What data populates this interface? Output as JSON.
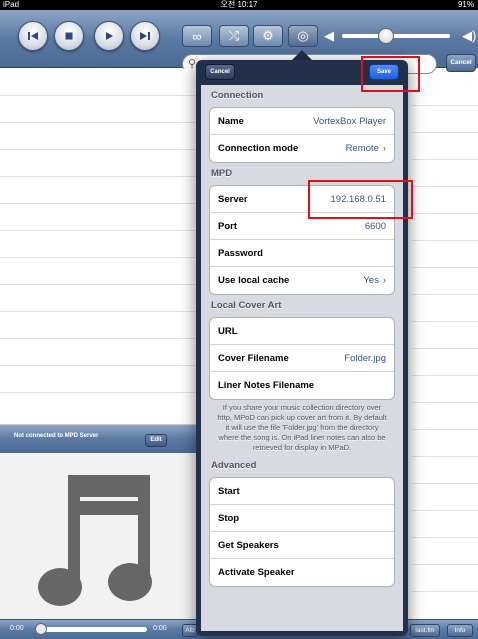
{
  "status_bar": {
    "device": "iPad",
    "time": "오전 10:17",
    "battery": "91%"
  },
  "search": {
    "placeholder": ""
  },
  "toolbar": {
    "cancel_label": "Cancel"
  },
  "now_playing": {
    "status": "Not connected to MPD Server",
    "edit_label": "Edit"
  },
  "bottom": {
    "elapsed": "0:00",
    "total": "0:00",
    "album_button": "Alb",
    "lastfm_button": "last.fm",
    "info_button": "Info"
  },
  "popover": {
    "cancel_label": "Cancel",
    "save_label": "Save",
    "connection": {
      "header": "Connection",
      "name": {
        "label": "Name",
        "value": "VortexBox Player"
      },
      "mode": {
        "label": "Connection mode",
        "value": "Remote"
      }
    },
    "mpd": {
      "header": "MPD",
      "server": {
        "label": "Server",
        "value": "192.168.0.51"
      },
      "port": {
        "label": "Port",
        "value": "6600"
      },
      "password": {
        "label": "Password",
        "value": ""
      },
      "cache": {
        "label": "Use local cache",
        "value": "Yes"
      }
    },
    "cover": {
      "header": "Local Cover Art",
      "url": {
        "label": "URL",
        "value": ""
      },
      "filename": {
        "label": "Cover Filename",
        "value": "Folder.jpg"
      },
      "liner": {
        "label": "Liner Notes Filename",
        "value": ""
      },
      "info": "If you share your music collection directory over http, MPoD can pick up cover art from it. By default it will use the file 'Folder.jpg' from the directory where the song is. On iPad liner notes can also be retrieved for display in MPaD."
    },
    "advanced": {
      "header": "Advanced",
      "items": [
        "Start",
        "Stop",
        "Get Speakers",
        "Activate Speaker"
      ]
    }
  },
  "colors": {
    "toolbar": "#5b7aa3",
    "popover": "#22304a",
    "save": "#1f5fe0",
    "highlight": "#e0101a"
  }
}
